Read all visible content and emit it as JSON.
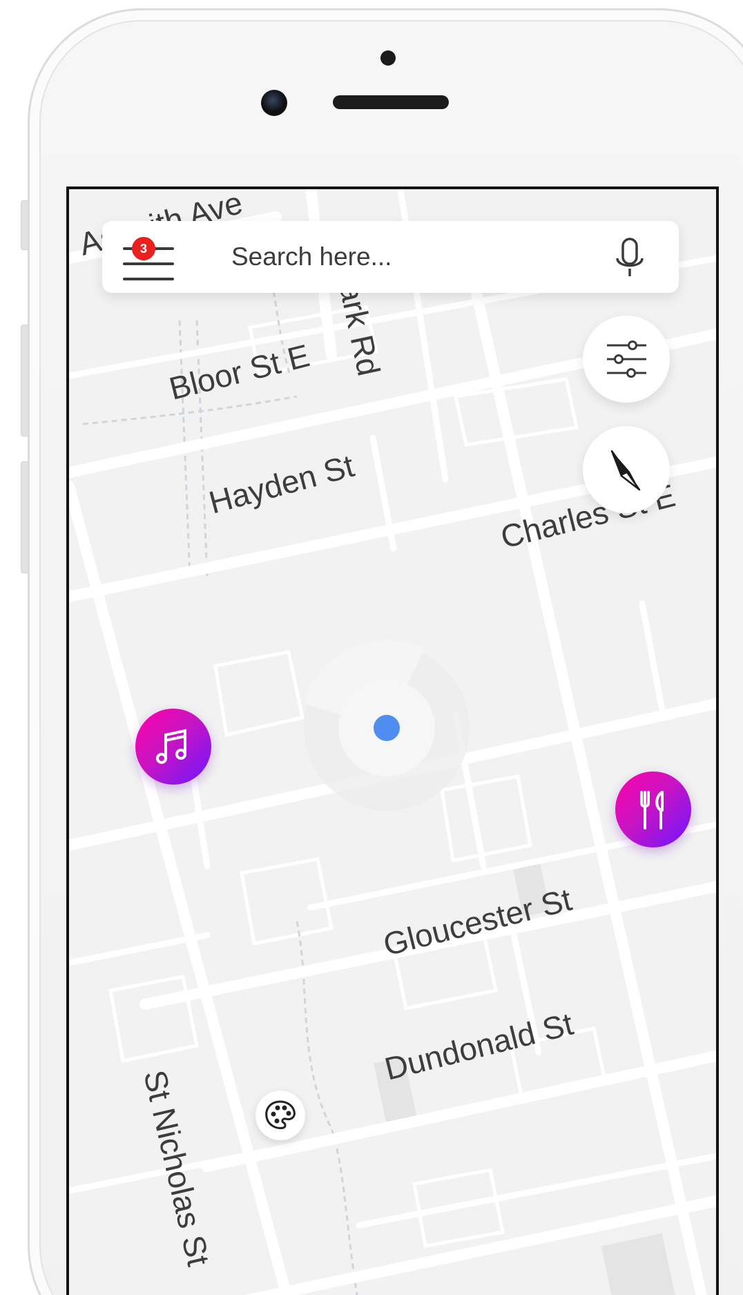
{
  "search": {
    "placeholder": "Search here...",
    "notification_count": "3"
  },
  "map": {
    "streets": {
      "asquith": "Asquith Ave",
      "park_rd": "Park Rd",
      "bloor": "Bloor St E",
      "hayden": "Hayden St",
      "charles": "Charles St E",
      "gloucester": "Gloucester St",
      "dundonald": "Dundonald St",
      "st_nicholas": "St Nicholas St"
    },
    "places": [
      {
        "category": "music",
        "icon": "music-note-icon"
      },
      {
        "category": "restaurant",
        "icon": "fork-knife-icon"
      },
      {
        "category": "art",
        "icon": "palette-icon"
      }
    ]
  },
  "controls": {
    "filter_icon": "sliders-icon",
    "locate_icon": "compass-arrow-icon",
    "mic_icon": "microphone-icon",
    "menu_icon": "hamburger-menu-icon"
  },
  "colors": {
    "badge": "#e8201e",
    "location_dot": "#4f8ef0",
    "poi_gradient_start": "#ff00a8",
    "poi_gradient_end": "#6b16ff",
    "map_background": "#f2f2f2",
    "road": "#ffffff"
  }
}
